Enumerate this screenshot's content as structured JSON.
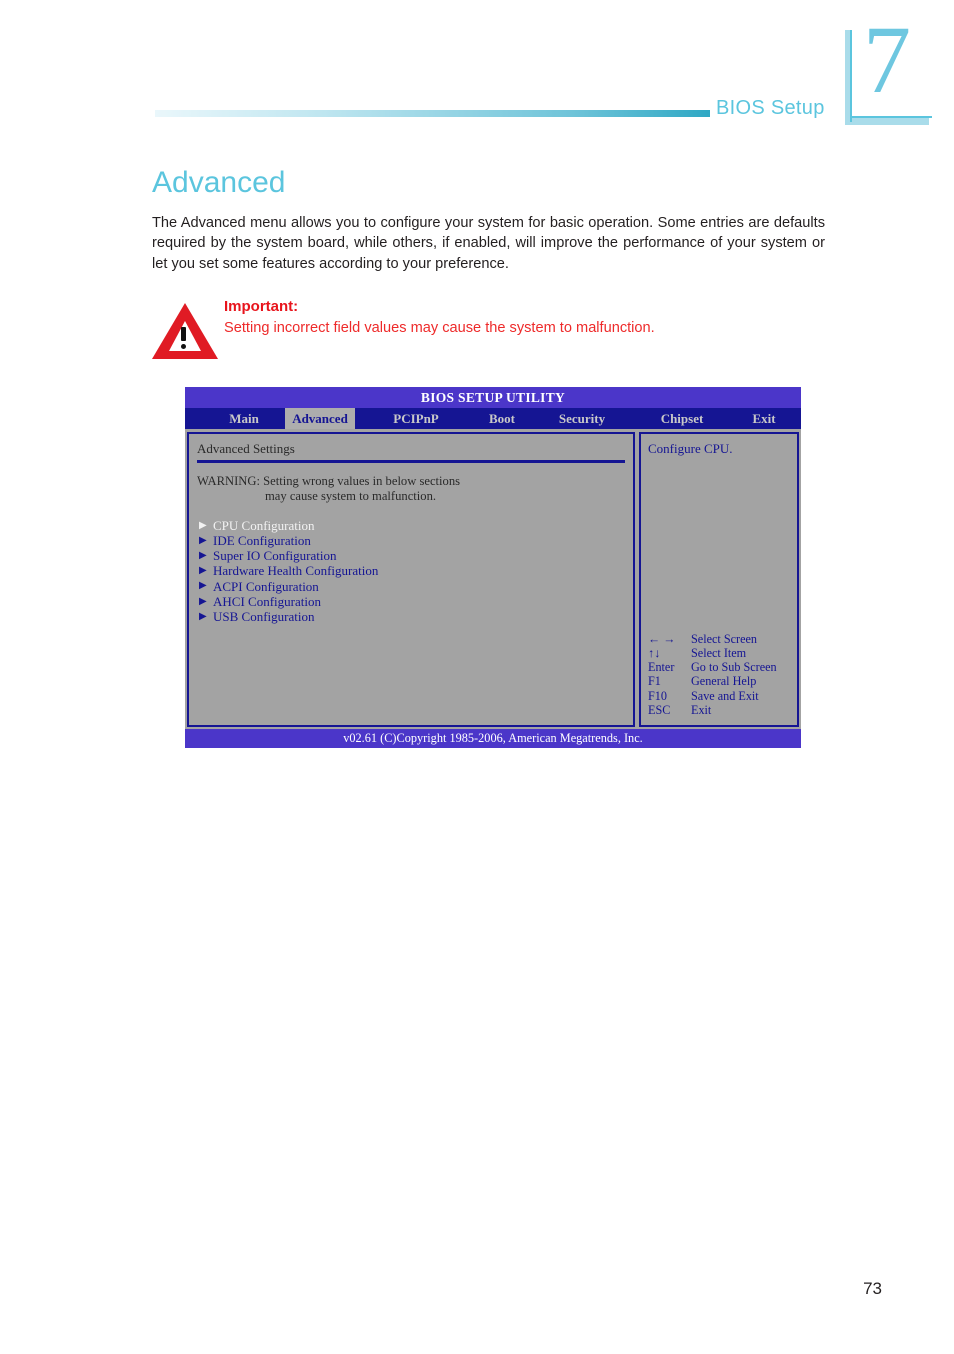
{
  "header": {
    "chapter_number": "7",
    "section_label": "BIOS Setup"
  },
  "page": {
    "title": "Advanced",
    "intro": "The Advanced menu allows you to configure your system for basic operation. Some entries are defaults required by the system board, while others, if enabled, will improve the performance of your system or let you set some features according to your preference.",
    "page_number": "73"
  },
  "callout": {
    "icon": "warning-triangle-icon",
    "title": "Important:",
    "text": "Setting incorrect field values may cause the system to malfunction."
  },
  "bios": {
    "title": "BIOS SETUP UTILITY",
    "tabs": [
      {
        "label": "Main",
        "active": false
      },
      {
        "label": "Advanced",
        "active": true
      },
      {
        "label": "PCIPnP",
        "active": false
      },
      {
        "label": "Boot",
        "active": false
      },
      {
        "label": "Security",
        "active": false
      },
      {
        "label": "Chipset",
        "active": false
      },
      {
        "label": "Exit",
        "active": false
      }
    ],
    "panel_heading": "Advanced Settings",
    "warning_line1_label": "WARNING:",
    "warning_line1": "Setting wrong values in below sections",
    "warning_line2": "may cause system to malfunction.",
    "menu_items": [
      {
        "label": "CPU Configuration",
        "selected": true
      },
      {
        "label": "IDE Configuration",
        "selected": false
      },
      {
        "label": "Super IO Configuration",
        "selected": false
      },
      {
        "label": "Hardware Health Configuration",
        "selected": false
      },
      {
        "label": "ACPI Configuration",
        "selected": false
      },
      {
        "label": "AHCI Configuration",
        "selected": false
      },
      {
        "label": "USB Configuration",
        "selected": false
      }
    ],
    "help_text": "Configure CPU.",
    "key_hints": [
      {
        "key": "← →",
        "desc": "Select Screen"
      },
      {
        "key": "↑↓",
        "desc": "Select Item"
      },
      {
        "key": "Enter",
        "desc": "Go to Sub Screen"
      },
      {
        "key": "F1",
        "desc": "General Help"
      },
      {
        "key": "F10",
        "desc": "Save and Exit"
      },
      {
        "key": "ESC",
        "desc": "Exit"
      }
    ],
    "footer": "v02.61 (C)Copyright 1985-2006, American Megatrends, Inc."
  },
  "colors": {
    "accent_cyan": "#5bc5de",
    "bios_title_bar": "#4b36c9",
    "bios_tab_bar": "#151593",
    "bios_panel_bg": "#a3a3a3",
    "warning_red": "#ee2a2a"
  }
}
